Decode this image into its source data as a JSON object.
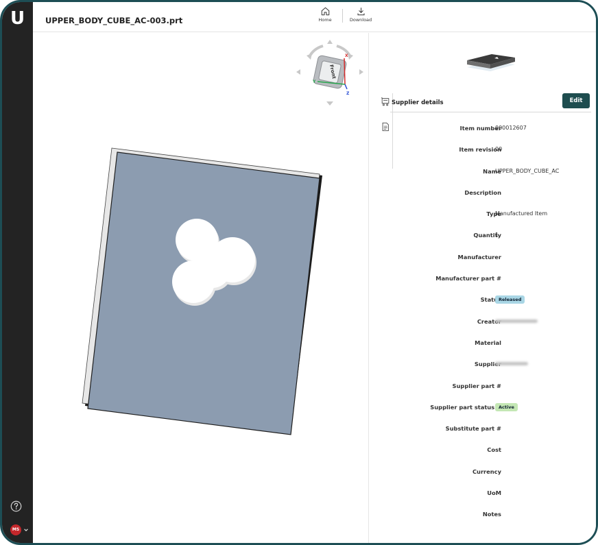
{
  "app": {
    "logo_letter": "U",
    "file_title": "UPPER_BODY_CUBE_AC-003.prt"
  },
  "toolbar": {
    "home_label": "Home",
    "download_label": "Download"
  },
  "user": {
    "initials": "MS"
  },
  "navcube": {
    "face_label": "Front",
    "axis_x": "X",
    "axis_y": "Y",
    "axis_z": "Z"
  },
  "panel": {
    "section_title": "Supplier details",
    "edit_label": "Edit",
    "fields": [
      {
        "label": "Item number",
        "value": "000012607"
      },
      {
        "label": "Item revision",
        "value": "00"
      },
      {
        "label": "Name",
        "value": "UPPER_BODY_CUBE_AC"
      },
      {
        "label": "Description",
        "value": ""
      },
      {
        "label": "Type",
        "value": "Manufactured Item"
      },
      {
        "label": "Quantity",
        "value": "1"
      },
      {
        "label": "Manufacturer",
        "value": ""
      },
      {
        "label": "Manufacturer part #",
        "value": ""
      },
      {
        "label": "Status",
        "value": "Released",
        "kind": "badge-released"
      },
      {
        "label": "Creator",
        "value": "",
        "kind": "blurred"
      },
      {
        "label": "Material",
        "value": ""
      },
      {
        "label": "Supplier",
        "value": "",
        "kind": "blurred-short"
      },
      {
        "label": "Supplier part #",
        "value": ""
      },
      {
        "label": "Supplier part status #",
        "value": "Active",
        "kind": "badge-active"
      },
      {
        "label": "Substitute part #",
        "value": ""
      },
      {
        "label": "Cost",
        "value": ""
      },
      {
        "label": "Currency",
        "value": ""
      },
      {
        "label": "UoM",
        "value": ""
      },
      {
        "label": "Notes",
        "value": ""
      }
    ]
  },
  "colors": {
    "rail": "#232323",
    "accent": "#1e4d4f",
    "frame_border": "#1d4e55",
    "part_fill": "#8c9cb0",
    "status_released": "#a9d6e5",
    "status_active": "#c4e7b4",
    "avatar": "#c4272b"
  },
  "icons": {
    "help": "help-circle-icon",
    "home": "home-icon",
    "download": "download-icon",
    "supplier_tab": "cart-icon",
    "document_tab": "document-icon"
  }
}
